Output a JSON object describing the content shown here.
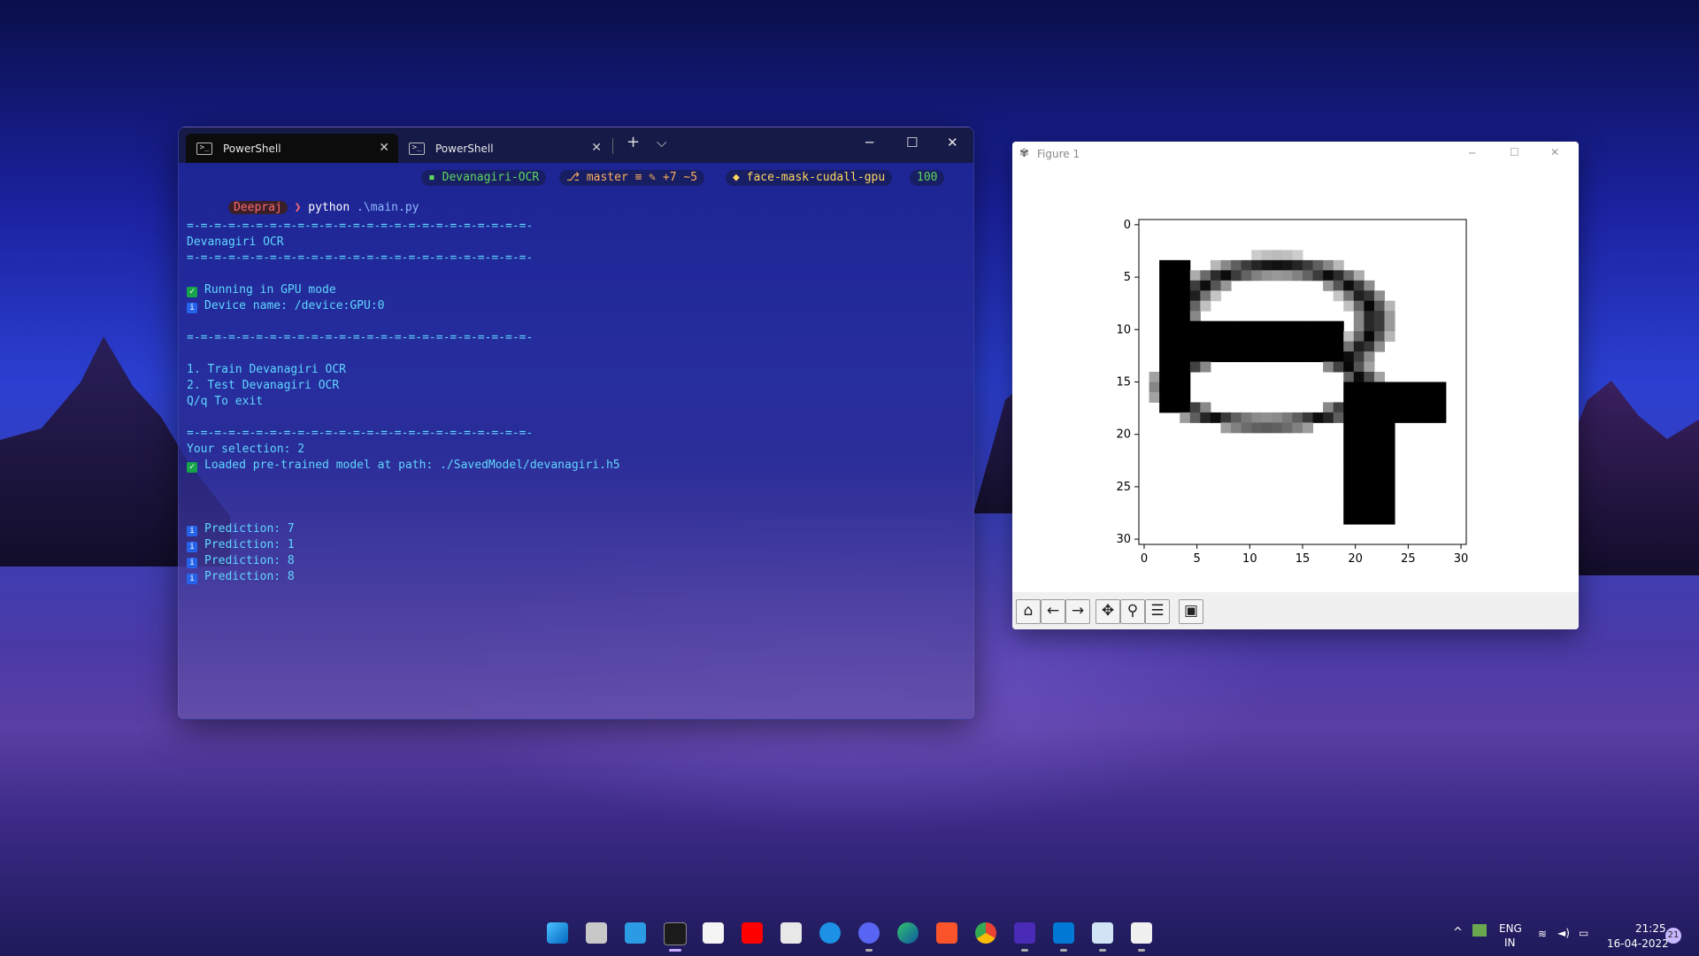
{
  "terminal": {
    "tabs": [
      {
        "label": "PowerShell"
      },
      {
        "label": "PowerShell"
      }
    ],
    "controls": {
      "new_tab": "+",
      "dropdown": "⌵"
    },
    "window_buttons": {
      "minimize": "─",
      "maximize": "☐",
      "close": "✕"
    },
    "prompt": {
      "user": "Deepraj",
      "command": "python",
      "arg": ".\\main.py"
    },
    "status_segments": {
      "folder": "Devanagiri-OCR",
      "branch": "master",
      "git_status": "≡ ✎ +7 ~5",
      "env": "face-mask-cudall-gpu",
      "number": "100"
    },
    "separator": "=-=-=-=-=-=-=-=-=-=-=-=-=-=-=-=-=-=-=-=-=-=-=-=-=-",
    "header_title": "Devanagiri OCR",
    "gpu_line": "Running in GPU mode",
    "device_line": "Device name: /device:GPU:0",
    "menu": [
      "1. Train Devanagiri OCR",
      "2. Test Devanagiri OCR",
      "Q/q To exit"
    ],
    "selection_line": "Your selection: 2",
    "loaded_line": "Loaded pre-trained model at path: ./SavedModel/devanagiri.h5",
    "predictions": [
      "Prediction: 7",
      "Prediction: 1",
      "Prediction: 8",
      "Prediction: 8"
    ],
    "colors": {
      "cyan": "#5fd7ff",
      "user_bg": "#3a1f2a",
      "user_fg": "#ff6b6b",
      "yellow": "#ffd75f",
      "green": "#5fd75f"
    }
  },
  "figure": {
    "title": "Figure 1",
    "window_buttons": {
      "minimize": "─",
      "maximize": "☐",
      "close": "✕"
    },
    "chart_data": {
      "type": "heatmap",
      "title": "",
      "xlabel": "",
      "ylabel": "",
      "xticks": [
        "0",
        "5",
        "10",
        "15",
        "20",
        "25",
        "30"
      ],
      "yticks": [
        "0",
        "5",
        "10",
        "15",
        "20",
        "25",
        "30"
      ],
      "xlim": [
        0,
        31
      ],
      "ylim": [
        31,
        0
      ],
      "colormap": "gray_r",
      "description_glyph": "handwritten Devanagari digit"
    },
    "toolbar": [
      {
        "name": "home",
        "glyph": "⌂"
      },
      {
        "name": "back",
        "glyph": "←"
      },
      {
        "name": "forward",
        "glyph": "→"
      },
      {
        "name": "pan",
        "glyph": "✥"
      },
      {
        "name": "zoom",
        "glyph": "⚲"
      },
      {
        "name": "configure",
        "glyph": "☰"
      },
      {
        "name": "save",
        "glyph": "▣"
      }
    ]
  },
  "taskbar": {
    "language": "ENG",
    "region": "IN",
    "time": "21:25",
    "date": "16-04-2022",
    "notifications": "21"
  }
}
